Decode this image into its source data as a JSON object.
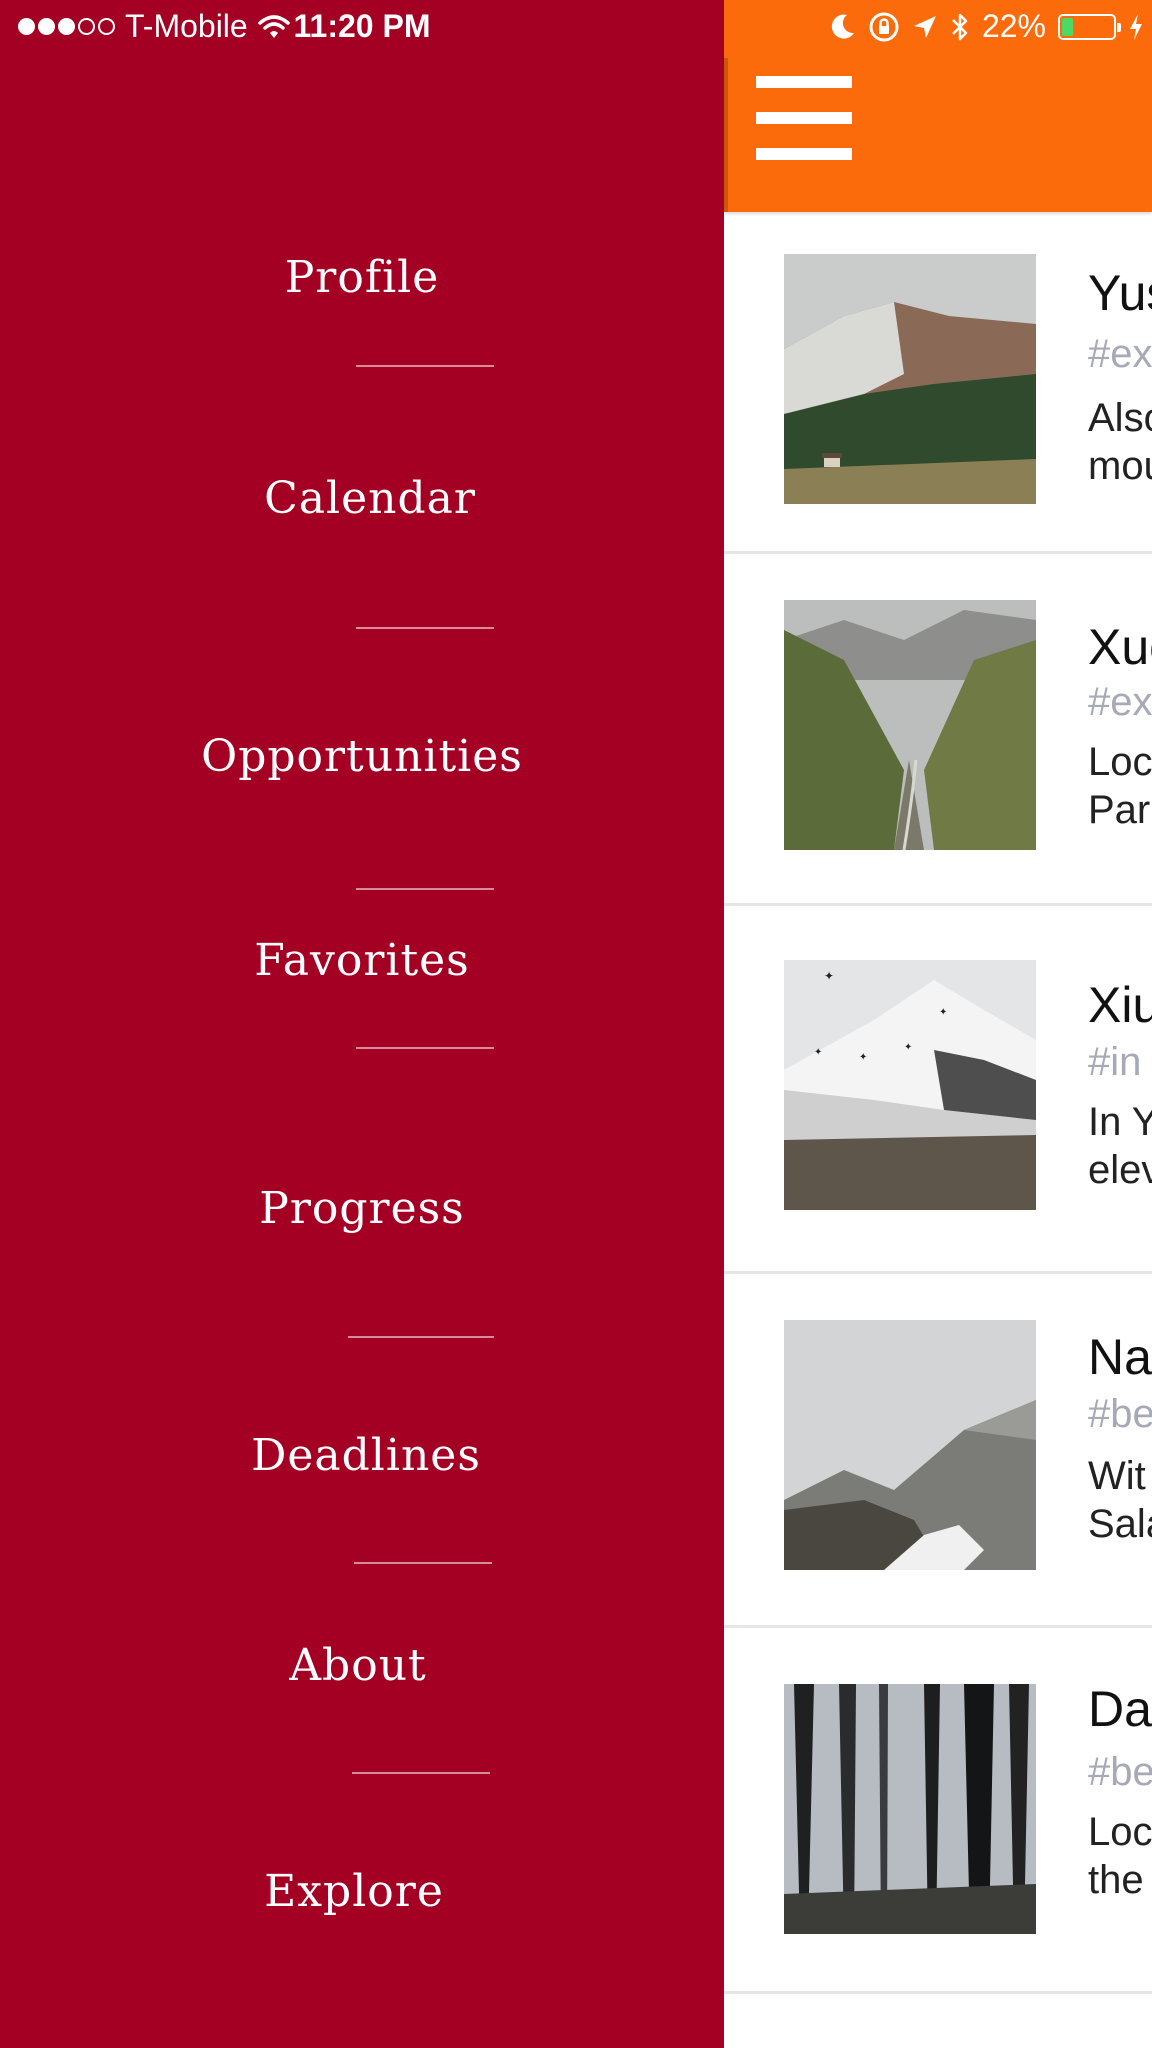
{
  "status_bar": {
    "carrier": "T-Mobile",
    "time": "11:20 PM",
    "battery_percent": "22%",
    "battery_level": 0.22,
    "battery_color": "#4cd964",
    "signal_bars": 3,
    "icons": [
      "wifi-icon",
      "moon-icon",
      "rotation-lock-icon",
      "location-arrow-icon",
      "bluetooth-icon",
      "charging-bolt-icon"
    ]
  },
  "colors": {
    "menu_background": "#a30024",
    "header_background": "#fb6b0c",
    "tag_gray": "#a7aab6"
  },
  "menu": {
    "items": [
      {
        "label": "Profile"
      },
      {
        "label": "Calendar"
      },
      {
        "label": "Opportunities"
      },
      {
        "label": "Favorites"
      },
      {
        "label": "Progress"
      },
      {
        "label": "Deadlines"
      },
      {
        "label": "About"
      },
      {
        "label": "Explore"
      }
    ]
  },
  "header": {
    "menu_icon": "hamburger-menu-icon"
  },
  "cards": [
    {
      "title": "Yus",
      "tag": "#ex",
      "desc_line1": "Also",
      "desc_line2": "mou",
      "image": "snowy mountain slope with a small hut"
    },
    {
      "title": "Xue",
      "tag": "#ex",
      "desc_line1": "Loc",
      "desc_line2": "Par",
      "image": "green mountain valley"
    },
    {
      "title": "Xiu",
      "tag": "#in",
      "desc_line1": "In Y",
      "desc_line2": "elev",
      "image": "snow-covered peak with birds"
    },
    {
      "title": "Na",
      "tag": "#be",
      "desc_line1": "Wit",
      "desc_line2": "Sala",
      "image": "misty mountains with snow patches"
    },
    {
      "title": "Da",
      "tag": "#be",
      "desc_line1": "Loc",
      "desc_line2": "the",
      "image": "forest with tall trees and sunlight"
    }
  ]
}
